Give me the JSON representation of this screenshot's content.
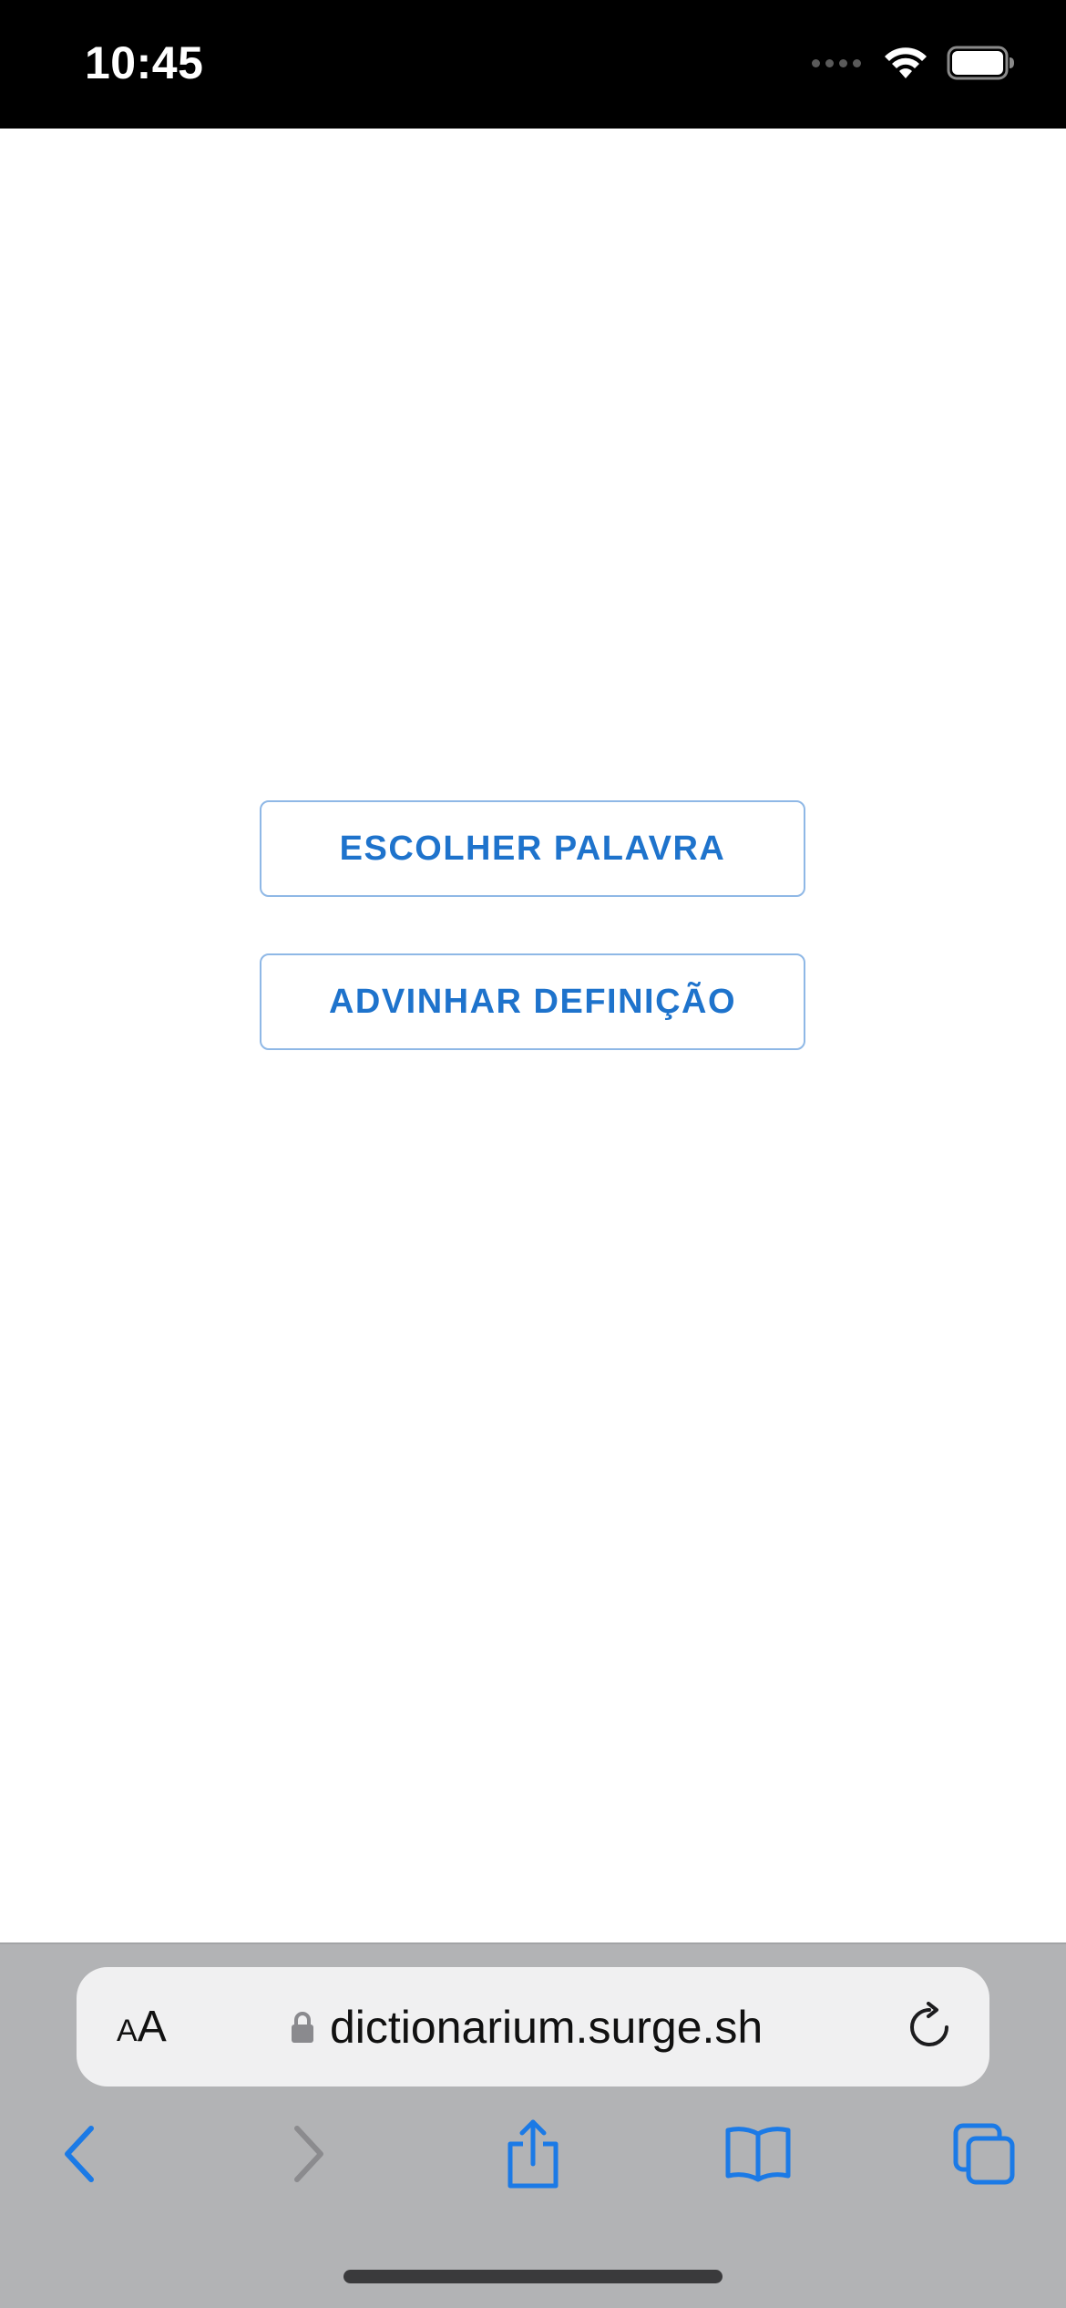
{
  "status_bar": {
    "time": "10:45",
    "icons": [
      "cellular-dots-icon",
      "wifi-icon",
      "battery-icon"
    ]
  },
  "main": {
    "buttons": [
      {
        "label": "ESCOLHER PALAVRA"
      },
      {
        "label": "ADVINHAR DEFINIÇÃO"
      }
    ],
    "accent_color": "#1e73cc",
    "border_color": "#8fb8e6"
  },
  "browser": {
    "aa_small": "A",
    "aa_large": "A",
    "url": "dictionarium.surge.sh",
    "chrome_color": "#b2b3b5",
    "address_bar_color": "#f0f0f1",
    "toolbar_icons": [
      "back-icon",
      "forward-icon",
      "share-icon",
      "bookmarks-icon",
      "tabs-icon"
    ]
  }
}
